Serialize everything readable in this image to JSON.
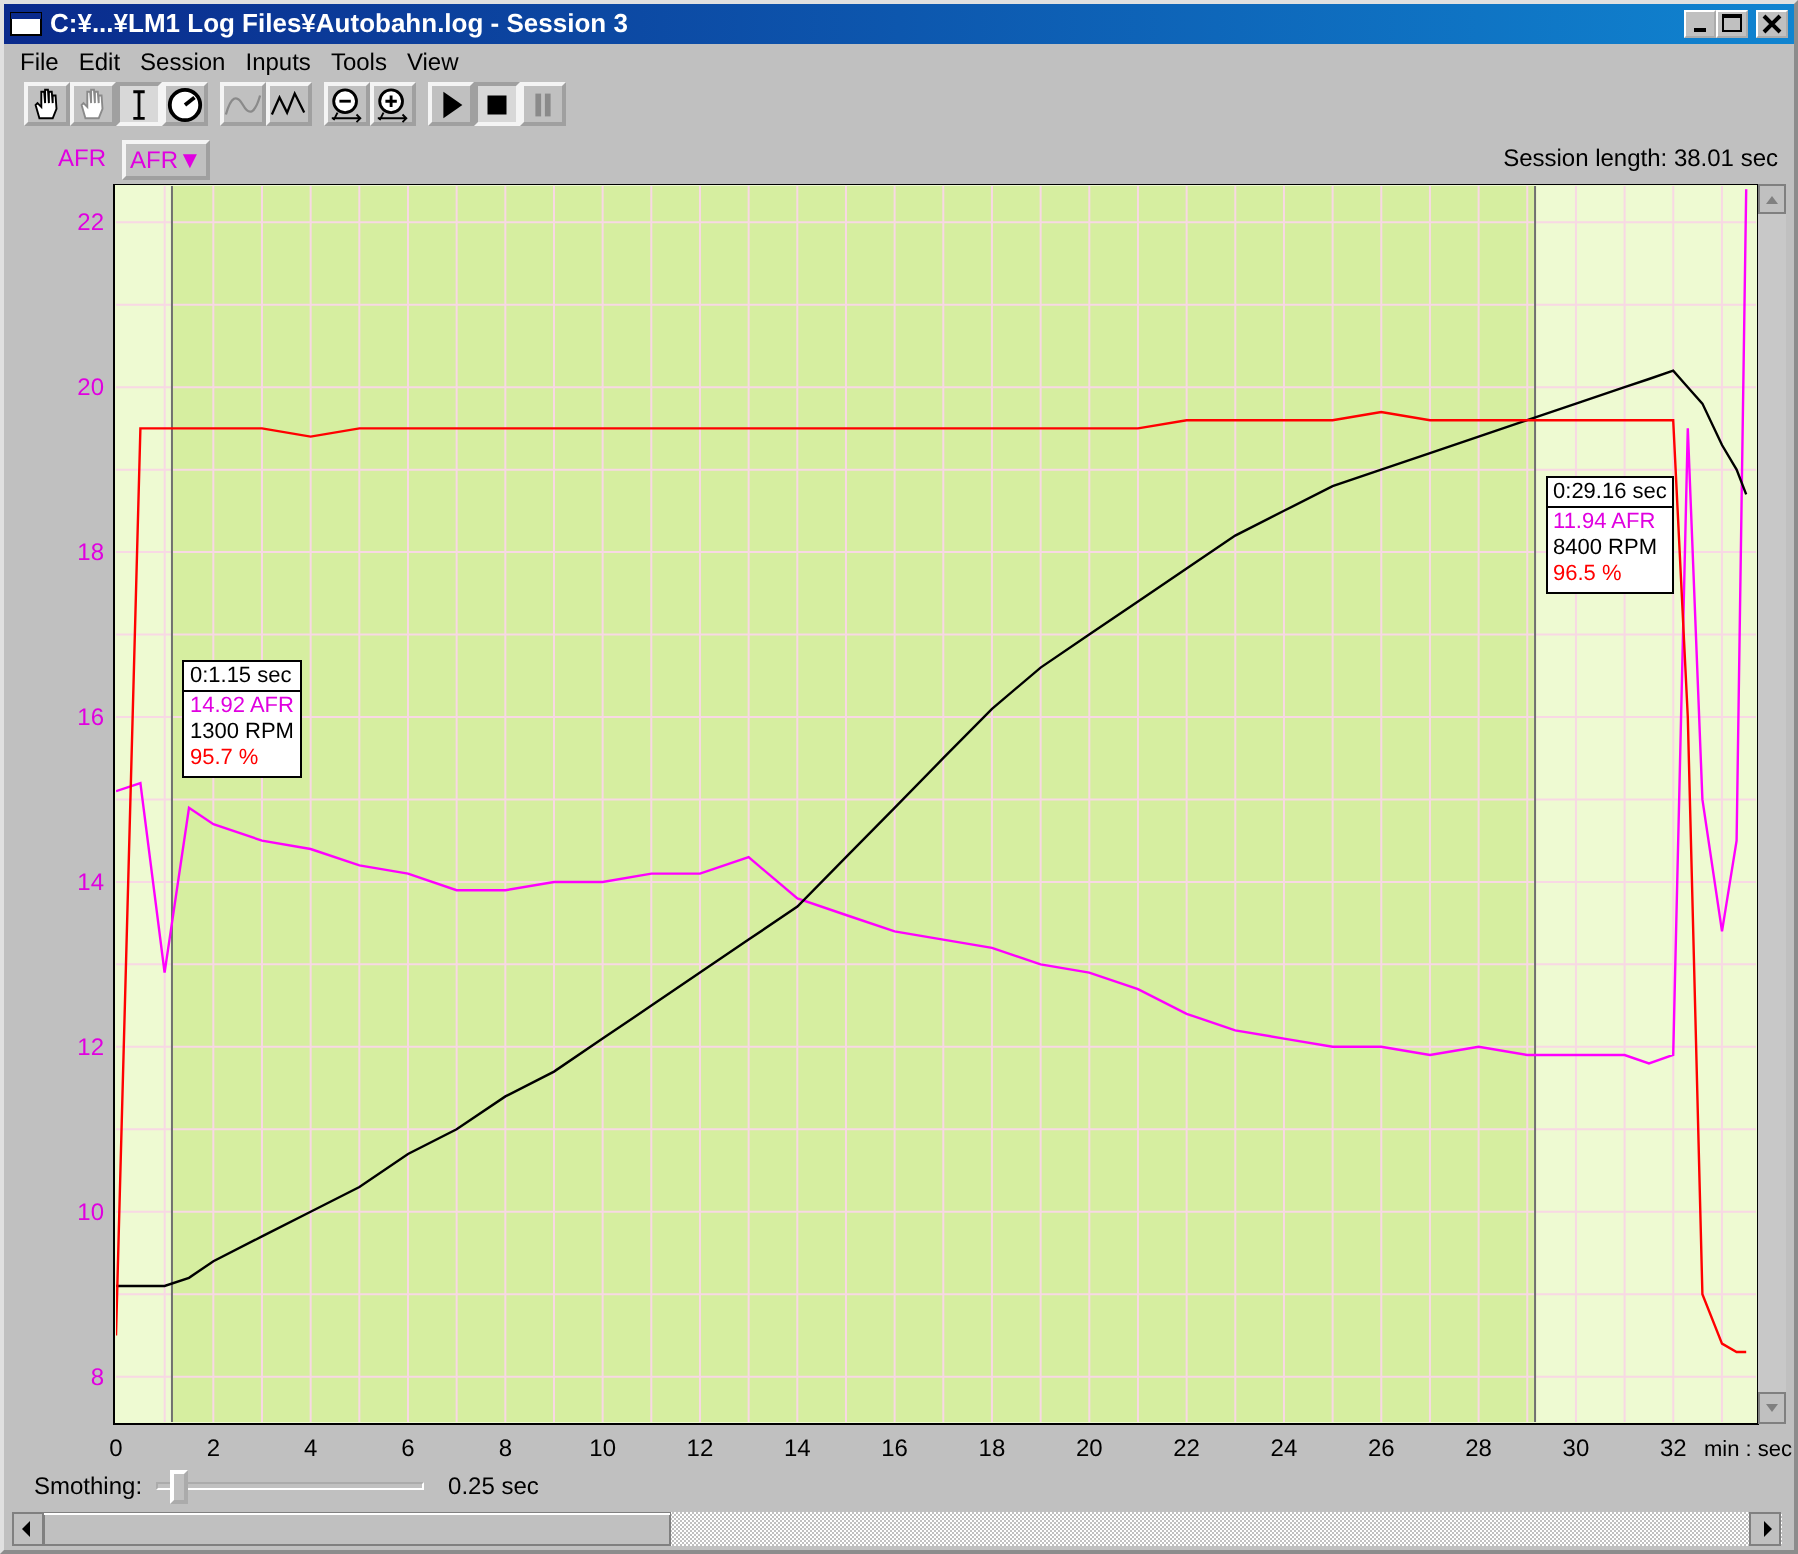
{
  "window": {
    "title": "C:¥...¥LM1 Log Files¥Autobahn.log - Session 3"
  },
  "menu": [
    "File",
    "Edit",
    "Session",
    "Inputs",
    "Tools",
    "View"
  ],
  "toolbar": [
    [
      {
        "kind": "hand",
        "pressed": false,
        "disabled": false
      },
      {
        "kind": "hand",
        "pressed": false,
        "disabled": true
      },
      {
        "kind": "ibeam",
        "pressed": true,
        "disabled": false
      },
      {
        "kind": "gauge",
        "pressed": false,
        "disabled": false
      }
    ],
    [
      {
        "kind": "smooth",
        "pressed": false,
        "disabled": true
      },
      {
        "kind": "zigzag",
        "pressed": false,
        "disabled": false
      }
    ],
    [
      {
        "kind": "zoomout",
        "pressed": false,
        "disabled": false
      },
      {
        "kind": "zoomin",
        "pressed": false,
        "disabled": false
      }
    ],
    [
      {
        "kind": "play",
        "pressed": false,
        "disabled": false
      },
      {
        "kind": "stop",
        "pressed": true,
        "disabled": false
      },
      {
        "kind": "pause",
        "pressed": false,
        "disabled": true
      }
    ]
  ],
  "channel_select": {
    "value": "AFR▼"
  },
  "session_length": "Session length:  38.01 sec",
  "chart_data": {
    "type": "line",
    "ylabel": "AFR",
    "xlabel": "min : sec",
    "x": [
      0,
      0.5,
      1,
      1.5,
      2,
      3,
      4,
      5,
      6,
      7,
      8,
      9,
      10,
      11,
      12,
      13,
      14,
      15,
      16,
      17,
      18,
      19,
      20,
      21,
      22,
      23,
      24,
      25,
      26,
      27,
      28,
      29,
      30,
      31,
      31.5,
      32,
      32.3,
      32.6,
      33,
      33.3,
      33.5
    ],
    "series": [
      {
        "color": "#ff00ff",
        "values": [
          15.1,
          15.2,
          12.9,
          14.9,
          14.7,
          14.5,
          14.4,
          14.2,
          14.1,
          13.9,
          13.9,
          14.0,
          14.0,
          14.1,
          14.1,
          14.3,
          13.8,
          13.6,
          13.4,
          13.3,
          13.2,
          13.0,
          12.9,
          12.7,
          12.4,
          12.2,
          12.1,
          12.0,
          12.0,
          11.9,
          12.0,
          11.9,
          11.9,
          11.9,
          11.8,
          11.9,
          19.5,
          15.0,
          13.4,
          14.5,
          22.4
        ]
      },
      {
        "color": "#000000",
        "values": [
          9.1,
          9.1,
          9.1,
          9.2,
          9.4,
          9.7,
          10.0,
          10.3,
          10.7,
          11.0,
          11.4,
          11.7,
          12.1,
          12.5,
          12.9,
          13.3,
          13.7,
          14.3,
          14.9,
          15.5,
          16.1,
          16.6,
          17.0,
          17.4,
          17.8,
          18.2,
          18.5,
          18.8,
          19.0,
          19.2,
          19.4,
          19.6,
          19.8,
          20.0,
          20.1,
          20.2,
          20.0,
          19.8,
          19.3,
          19.0,
          18.7
        ]
      },
      {
        "color": "#ff0000",
        "values": [
          8.5,
          19.5,
          19.5,
          19.5,
          19.5,
          19.5,
          19.4,
          19.5,
          19.5,
          19.5,
          19.5,
          19.5,
          19.5,
          19.5,
          19.5,
          19.5,
          19.5,
          19.5,
          19.5,
          19.5,
          19.5,
          19.5,
          19.5,
          19.5,
          19.6,
          19.6,
          19.6,
          19.6,
          19.7,
          19.6,
          19.6,
          19.6,
          19.6,
          19.6,
          19.6,
          19.6,
          16.0,
          9.0,
          8.4,
          8.3,
          8.3
        ]
      }
    ],
    "xlim": [
      0,
      33.7
    ],
    "ylim": [
      7.45,
      22.44
    ],
    "xticks": [
      0,
      2,
      4,
      6,
      8,
      10,
      12,
      14,
      16,
      18,
      20,
      22,
      24,
      26,
      28,
      30,
      32
    ],
    "yticks": [
      8,
      10,
      12,
      14,
      16,
      18,
      20,
      22
    ],
    "grid": true,
    "ref_lines": [
      {
        "axis": "x",
        "value": 1.15,
        "label": "0:1.15 sec"
      },
      {
        "axis": "x",
        "value": 29.16,
        "label": "0:29.16 sec"
      }
    ],
    "bands": [
      {
        "axis": "x",
        "from": 1.15,
        "to": 29.16
      }
    ]
  },
  "cursors": [
    {
      "afr": "14.92 AFR",
      "rpm": "1300 RPM",
      "percent": "95.7 %"
    },
    {
      "afr": "11.94 AFR",
      "rpm": "8400 RPM",
      "percent": "96.5 %"
    }
  ],
  "smoothing": {
    "label": "Smothing:",
    "level": 0.06,
    "reading": "0.25 sec"
  }
}
